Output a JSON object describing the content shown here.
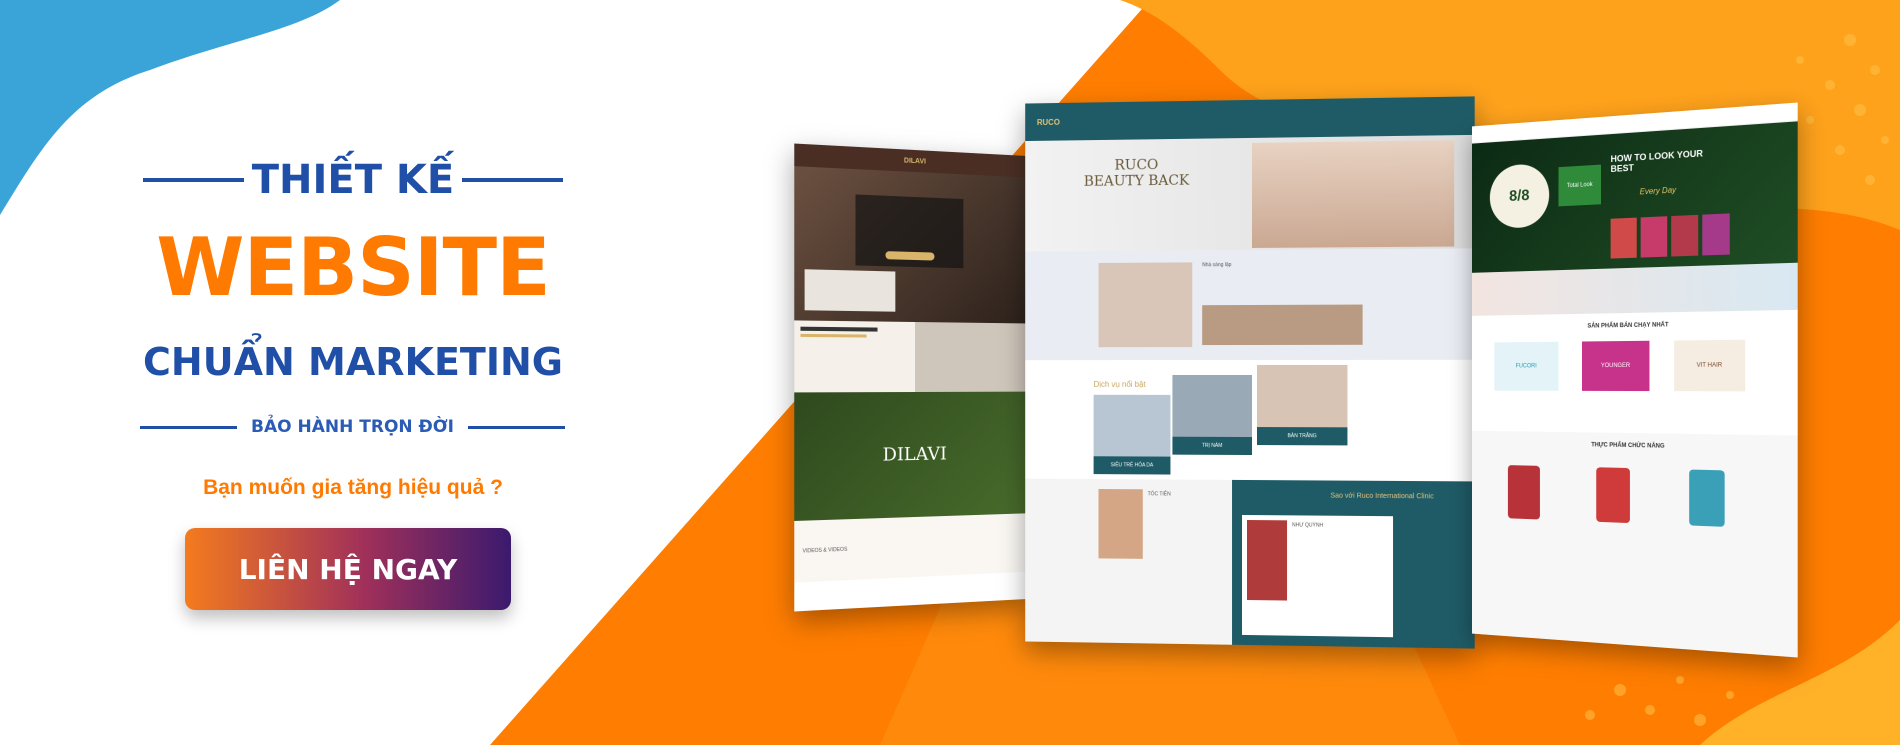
{
  "banner": {
    "title_top": "THIẾT KẾ",
    "title_main": "WEBSITE",
    "title_sub": "CHUẨN MARKETING",
    "warranty": "BẢO HÀNH TRỌN ĐỜI",
    "question": "Bạn muốn gia tăng hiệu quả ?",
    "cta_label": "LIÊN HỆ NGAY"
  },
  "mockups": {
    "left": {
      "brand": "DILAVI",
      "section_label": "VIDEOS & VIDEOS"
    },
    "center": {
      "brand": "RUCO",
      "hero_title": "RUCO",
      "hero_subtitle": "BEAUTY BACK",
      "section_about": "Nhà sáng lập",
      "section_services": "Dịch vụ nổi bật",
      "service_1": "SIÊU TRẺ HÓA DA",
      "service_2": "TRỊ NÁM",
      "service_3": "BẢN TRẮNG",
      "profile_name": "TÓC TIÊN",
      "clinic_title": "Sao với Ruco International Clinic",
      "clinic_person": "NHƯ QUỲNH"
    },
    "right": {
      "promo_title": "HOW TO LOOK YOUR BEST",
      "promo_sub": "Every Day",
      "promo_date": "8/8",
      "promo_brand": "Total Look",
      "section_bestseller": "SẢN PHẨM BÁN CHẠY NHẤT",
      "product_1": "FUCORI",
      "product_2": "YOUNGER",
      "product_3": "VIT HAIR",
      "section_functional": "THỰC PHẨM CHỨC NĂNG"
    }
  },
  "colors": {
    "orange": "#ff7a00",
    "blue": "#1f4fa6",
    "teal": "#1e5b66"
  }
}
